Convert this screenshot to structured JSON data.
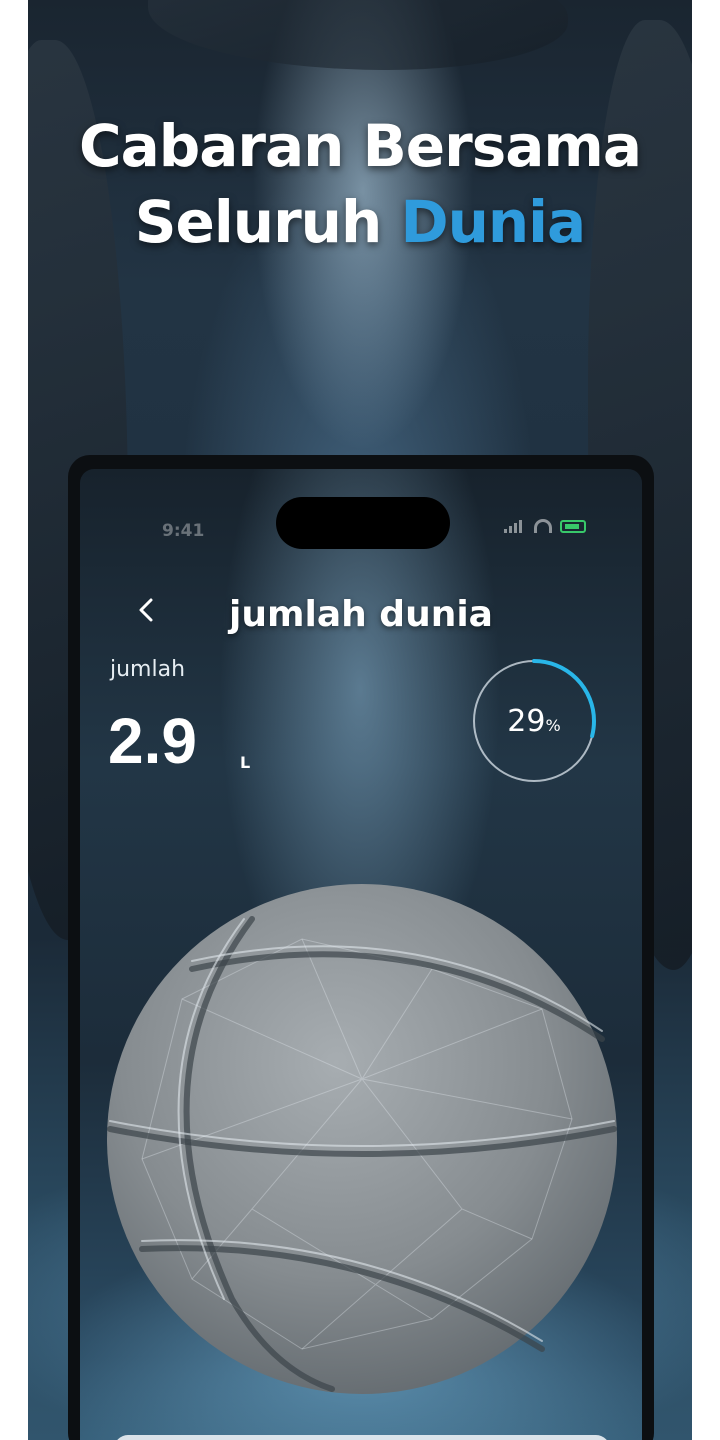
{
  "headline": {
    "line1": "Cabaran Bersama",
    "line2_prefix": "Seluruh",
    "line2_accent": "Dunia"
  },
  "status_bar": {
    "time": "9:41",
    "battery_color": "#38c86a"
  },
  "screen": {
    "back_icon": "chevron-left-icon",
    "title": "jumlah dunia",
    "total_label": "jumlah",
    "total_value": "2.9",
    "total_unit": "L",
    "progress_percent_value": "29",
    "progress_percent_sign": "%",
    "progress_fraction": 0.29,
    "ring_color": "#29b6e8"
  },
  "colors": {
    "accent": "#2f9bdc"
  }
}
